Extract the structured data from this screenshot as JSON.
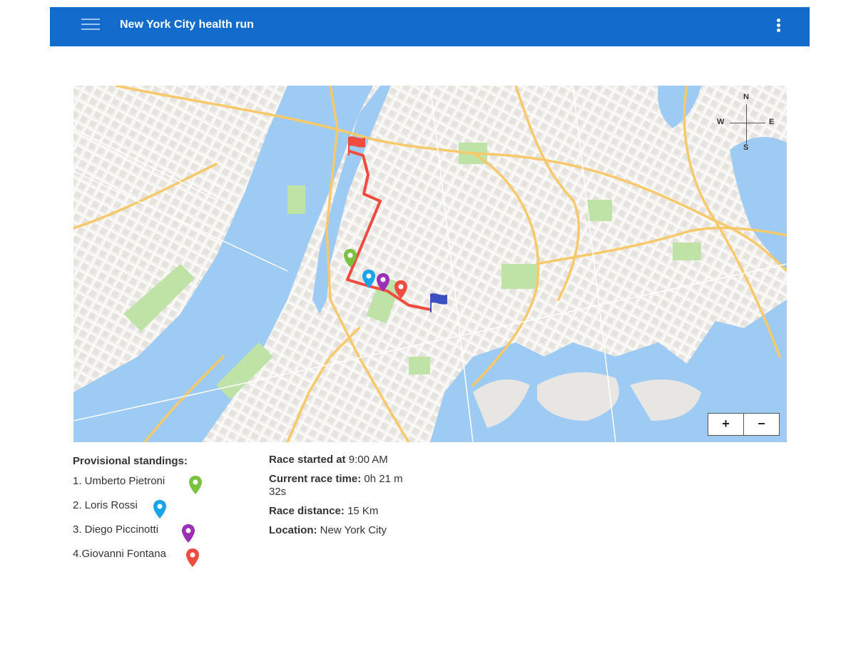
{
  "header": {
    "title": "New York City health run"
  },
  "map": {
    "compass": {
      "n": "N",
      "s": "S",
      "e": "E",
      "w": "W"
    },
    "zoom": {
      "in_label": "+",
      "out_label": "−"
    },
    "route_color": "#f04b3f",
    "start_flag_color": "#f04b3f",
    "finish_flag_color": "#3c4fc2",
    "markers": [
      {
        "runner": "Umberto Pietroni",
        "color": "#7cc242"
      },
      {
        "runner": "Loris Rossi",
        "color": "#1aa3e8"
      },
      {
        "runner": "Diego Piccinotti",
        "color": "#9b2fb5"
      },
      {
        "runner": "Giovanni Fontana",
        "color": "#f04b3f"
      }
    ]
  },
  "standings": {
    "title": "Provisional standings:",
    "runners": [
      {
        "label": "1. Umberto Pietroni",
        "color": "#7cc242"
      },
      {
        "label": "2. Loris Rossi",
        "color": "#1aa3e8"
      },
      {
        "label": "3. Diego Piccinotti",
        "color": "#9b2fb5"
      },
      {
        "label": "4.Giovanni Fontana",
        "color": "#f04b3f"
      }
    ]
  },
  "race_info": {
    "start_label": "Race started at",
    "start_value": "9:00 AM",
    "time_label": "Current race time:",
    "time_value": "0h 21 m 32s",
    "distance_label": "Race distance:",
    "distance_value": "15 Km",
    "location_label": "Location:",
    "location_value": "New York City"
  }
}
